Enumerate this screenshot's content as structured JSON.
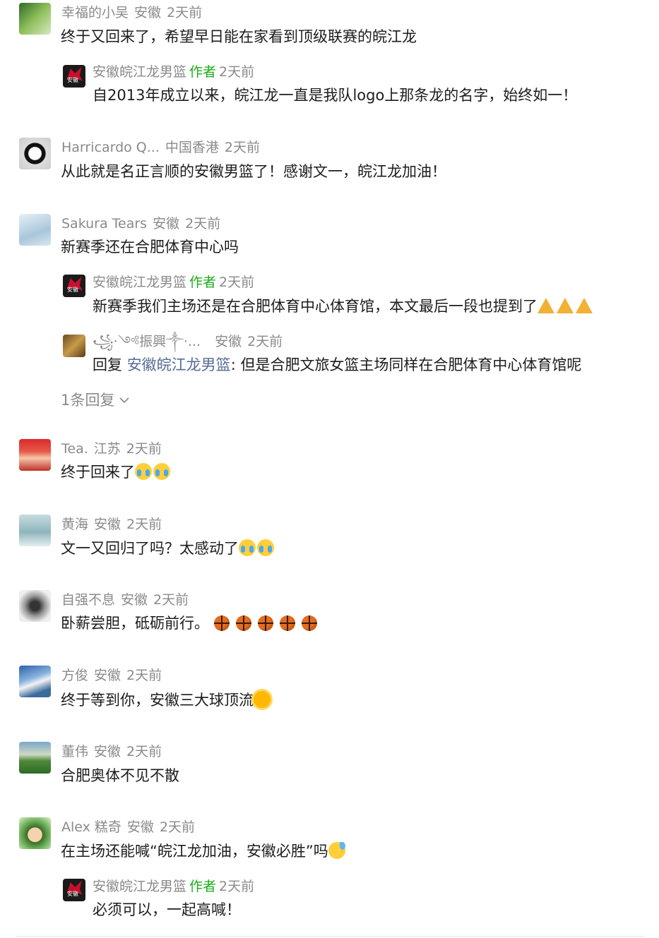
{
  "comments": [
    {
      "user": "幸福的小吴",
      "loc": "安徽",
      "time": "2天前",
      "text": "终于又回来了，希望早日能在家看到顶级联赛的皖江龙"
    },
    {
      "user": "Harricardo Q...",
      "loc": "中国香港",
      "time": "2天前",
      "text": "从此就是名正言顺的安徽男篮了！感谢文一，皖江龙加油！"
    },
    {
      "user": "Sakura Tears",
      "loc": "安徽",
      "time": "2天前",
      "text": "新赛季还在合肥体育中心吗"
    },
    {
      "user": "Tea.",
      "loc": "江苏",
      "time": "2天前",
      "text": "终于回来了"
    },
    {
      "user": "黄海",
      "loc": "安徽",
      "time": "2天前",
      "text": "文一又回归了吗？太感动了"
    },
    {
      "user": "自强不息",
      "loc": "安徽",
      "time": "2天前",
      "text": "卧薪尝胆，砥砺前行。"
    },
    {
      "user": "方俊",
      "loc": "安徽",
      "time": "2天前",
      "text": "终于等到你，安徽三大球顶流"
    },
    {
      "user": "董伟",
      "loc": "安徽",
      "time": "2天前",
      "text": "合肥奥体不见不散"
    },
    {
      "user": "Alex 糕奇",
      "loc": "安徽",
      "time": "2天前",
      "text": "在主场还能喊“皖江龙加油，安徽必胜”吗"
    }
  ],
  "replies": [
    {
      "user": "安徽皖江龙男篮",
      "badge": "作者",
      "time": "2天前",
      "text": "自2013年成立以来，皖江龙一直是我队logo上那条龙的名字，始终如一！"
    },
    {
      "user": "安徽皖江龙男篮",
      "badge": "作者",
      "time": "2天前",
      "text": "新赛季我们主场还是在合肥体育中心体育馆，本文最后一段也提到了"
    },
    {
      "user": "꧁·༺振興༒·...",
      "loc": "安徽",
      "time": "2天前",
      "prefix": "回复",
      "target": "安徽皖江龙男篮",
      "text": ": 但是合肥文旅女篮主场同样在合肥体育中心体育馆呢"
    },
    {
      "user": "安徽皖江龙男篮",
      "badge": "作者",
      "time": "2天前",
      "text": "必须可以，一起高喊！"
    }
  ],
  "more_replies": "1条回复",
  "icons": {
    "more": "chevron-down-icon",
    "logo": "dragon-logo-icon"
  }
}
